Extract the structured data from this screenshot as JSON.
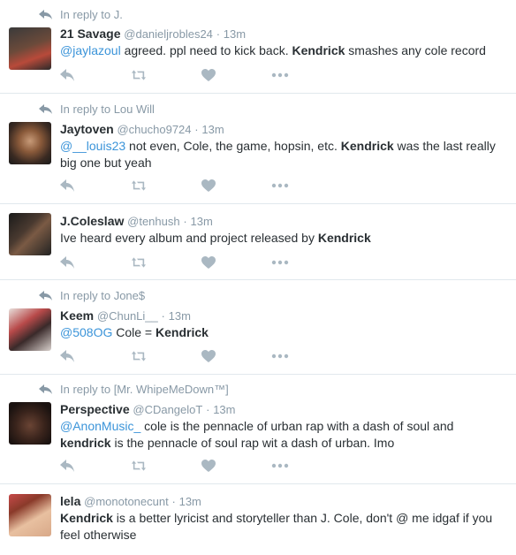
{
  "tweets": [
    {
      "reply_context": "In reply to J.",
      "name": "21 Savage",
      "handle": "@danieljrobles24",
      "sep": "·",
      "time": "13m",
      "parts": [
        {
          "t": "@jaylazoul",
          "s": "mention"
        },
        {
          "t": " agreed. ppl need to kick back. ",
          "s": "plain"
        },
        {
          "t": "Kendrick",
          "s": "kw"
        },
        {
          "t": " smashes any cole record",
          "s": "plain"
        }
      ]
    },
    {
      "reply_context": "In reply to Lou Will",
      "name": "Jaytoven",
      "handle": "@chucho9724",
      "sep": "·",
      "time": "13m",
      "parts": [
        {
          "t": "@__louis23",
          "s": "mention"
        },
        {
          "t": " not even, Cole, the game, hopsin, etc. ",
          "s": "plain"
        },
        {
          "t": "Kendrick",
          "s": "kw"
        },
        {
          "t": " was the last really big one but yeah",
          "s": "plain"
        }
      ]
    },
    {
      "reply_context": "",
      "name": "J.Coleslaw",
      "handle": "@tenhush",
      "sep": "·",
      "time": "13m",
      "parts": [
        {
          "t": "Ive heard every album and project released by ",
          "s": "plain"
        },
        {
          "t": "Kendrick",
          "s": "kw"
        }
      ]
    },
    {
      "reply_context": "In reply to Jone$",
      "name": "Keem",
      "handle": "@ChunLi__",
      "sep": "·",
      "time": "13m",
      "parts": [
        {
          "t": "@508OG",
          "s": "mention"
        },
        {
          "t": " Cole = ",
          "s": "plain"
        },
        {
          "t": "Kendrick",
          "s": "kw"
        }
      ]
    },
    {
      "reply_context": "In reply to [Mr. WhipeMeDown™]",
      "name": "Perspective",
      "handle": "@CDangeloT",
      "sep": "·",
      "time": "13m",
      "parts": [
        {
          "t": "@AnonMusic_",
          "s": "mention"
        },
        {
          "t": " cole is the pennacle of urban rap with a dash of soul and ",
          "s": "plain"
        },
        {
          "t": "kendrick",
          "s": "kw"
        },
        {
          "t": " is the pennacle of soul rap wit a dash of urban. Imo",
          "s": "plain"
        }
      ]
    },
    {
      "reply_context": "",
      "name": "lela",
      "handle": "@monotonecunt",
      "sep": "·",
      "time": "13m",
      "parts": [
        {
          "t": "Kendrick",
          "s": "kw"
        },
        {
          "t": " is a better lyricist and storyteller than J. Cole, don't @ me idgaf if you feel otherwise",
          "s": "plain"
        }
      ]
    }
  ],
  "icons": {
    "reply": "reply-icon",
    "retweet": "retweet-icon",
    "like": "heart-icon",
    "more": "more-icon"
  },
  "colors": {
    "mention": "#3b94d9",
    "muted": "#8899a6",
    "action_icon": "#aab8c2",
    "text": "#292f33",
    "divider": "#e1e8ed"
  }
}
